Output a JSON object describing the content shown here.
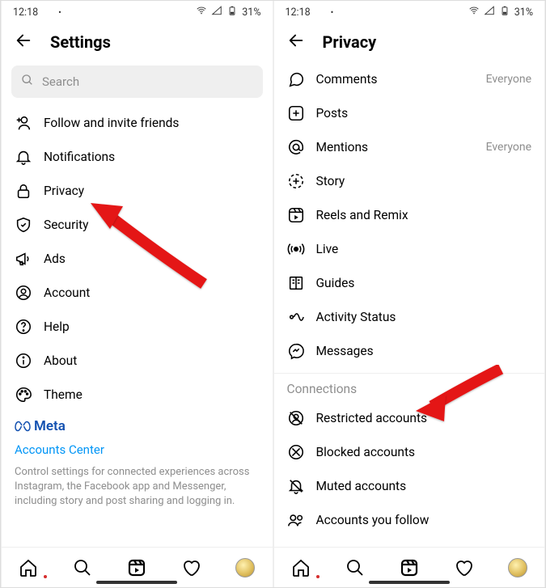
{
  "status": {
    "time": "12:18",
    "battery": "31%"
  },
  "screen1": {
    "title": "Settings",
    "search_placeholder": "Search",
    "items": {
      "follow": "Follow and invite friends",
      "notifications": "Notifications",
      "privacy": "Privacy",
      "security": "Security",
      "ads": "Ads",
      "account": "Account",
      "help": "Help",
      "about": "About",
      "theme": "Theme"
    },
    "meta": {
      "logo": "Meta",
      "accounts_center": "Accounts Center",
      "desc": "Control settings for connected experiences across Instagram, the Facebook app and Messenger, including story and post sharing and logging in."
    }
  },
  "screen2": {
    "title": "Privacy",
    "items": {
      "comments": {
        "label": "Comments",
        "value": "Everyone"
      },
      "posts": {
        "label": "Posts"
      },
      "mentions": {
        "label": "Mentions",
        "value": "Everyone"
      },
      "story": {
        "label": "Story"
      },
      "reels": {
        "label": "Reels and Remix"
      },
      "live": {
        "label": "Live"
      },
      "guides": {
        "label": "Guides"
      },
      "activity": {
        "label": "Activity Status"
      },
      "messages": {
        "label": "Messages"
      }
    },
    "connections": {
      "header": "Connections",
      "restricted": "Restricted accounts",
      "blocked": "Blocked accounts",
      "muted": "Muted accounts",
      "follow": "Accounts you follow"
    }
  }
}
